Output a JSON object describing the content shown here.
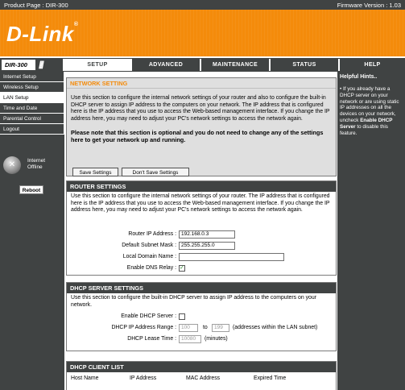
{
  "topbar": {
    "product": "Product Page :  DIR-300",
    "firmware": "Firmware Version : 1.03"
  },
  "brand": {
    "logo": "D-Link",
    "reg": "®"
  },
  "nav": {
    "model": "DIR-300",
    "tabs": [
      {
        "label": "SETUP"
      },
      {
        "label": "ADVANCED"
      },
      {
        "label": "MAINTENANCE"
      },
      {
        "label": "STATUS"
      },
      {
        "label": "HELP"
      }
    ]
  },
  "sidebar": {
    "items": [
      {
        "label": "Internet Setup"
      },
      {
        "label": "Wireless Setup"
      },
      {
        "label": "LAN Setup"
      },
      {
        "label": "Time and Date"
      },
      {
        "label": "Parental Control"
      },
      {
        "label": "Logout"
      }
    ],
    "internet_status_line1": "Internet",
    "internet_status_line2": "Offline",
    "reboot": "Reboot"
  },
  "network_setting": {
    "title": "NETWORK SETTING",
    "desc": "Use this section to configure the internal network settings of your router and also to configure the built-in DHCP server to assign IP address to the computers on your network. The IP address that is configured here is the IP address that you use to access the Web-based management interface. If you change the IP address here, you may need to adjust your PC's network settings to access the network again.",
    "note": "Please note that this section is optional and you do not need to change any of the settings here to get your network up and running.",
    "save": "Save Settings",
    "dont_save": "Don't Save Settings"
  },
  "router_settings": {
    "title": "ROUTER SETTINGS",
    "desc": "Use this section to configure the internal network settings of your router. The IP address that is configured here is the IP address that you use to access the Web-based management interface. If you change the IP address here, you may need to adjust your PC's network settings to access the network again.",
    "ip_label": "Router IP Address :",
    "ip_value": "192.168.0.3",
    "mask_label": "Default Subnet Mask :",
    "mask_value": "255.255.255.0",
    "domain_label": "Local Domain Name :",
    "domain_value": "",
    "dns_label": "Enable DNS Relay :",
    "dns_checked": true,
    "check_mark": "✓"
  },
  "dhcp_settings": {
    "title": "DHCP SERVER SETTINGS",
    "desc": "Use this section to configure the built-in DHCP server to assign IP address to the computers on your network.",
    "enable_label": "Enable DHCP Server :",
    "enable_checked": false,
    "range_label": "DHCP IP Address Range :",
    "range_start": "100",
    "range_to": "to",
    "range_end": "199",
    "range_note": "(addresses within the LAN subnet)",
    "lease_label": "DHCP Lease Time :",
    "lease_value": "10080",
    "lease_unit": "(minutes)"
  },
  "dhcp_clients": {
    "title": "DHCP CLIENT LIST",
    "columns": [
      "Host Name",
      "IP Address",
      "MAC Address",
      "Expired Time"
    ]
  },
  "hints": {
    "title": "Helpful Hints..",
    "bullet": "•",
    "text_pre": "If you already have a DHCP server on your network or are using static IP addresses on all the devices on your network, uncheck ",
    "text_bold": "Enable DHCP Server",
    "text_post": " to disable this feature."
  }
}
